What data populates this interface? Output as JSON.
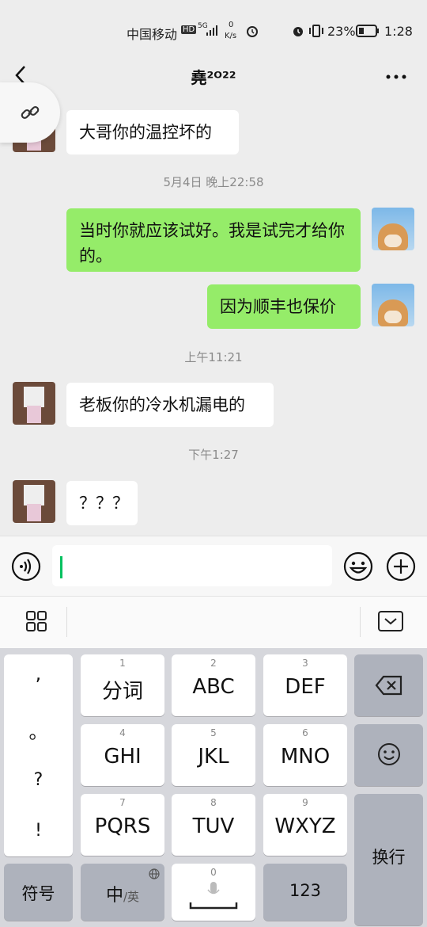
{
  "status_bar": {
    "carrier": "中国移动",
    "hd_badge": "HD",
    "net_type": "5G",
    "speed_value": "0",
    "speed_unit": "K/s",
    "battery_percent": "23%",
    "time": "1:28"
  },
  "chat": {
    "title": "堯²ᴼ²²",
    "messages": [
      {
        "side": "left",
        "text": "大哥你的温控坏的"
      },
      {
        "timestamp": "5月4日 晚上22:58"
      },
      {
        "side": "right",
        "text": "当时你就应该试好。我是试完才给你的。"
      },
      {
        "side": "right",
        "text": "因为顺丰也保价"
      },
      {
        "timestamp": "上午11:21"
      },
      {
        "side": "left",
        "text": "老板你的冷水机漏电的"
      },
      {
        "timestamp": "下午1:27"
      },
      {
        "side": "left",
        "text": "？？？"
      }
    ]
  },
  "input": {
    "value": ""
  },
  "keyboard": {
    "punct": [
      ",",
      "。",
      "?",
      "!"
    ],
    "keys": [
      {
        "num": "1",
        "label": "分词"
      },
      {
        "num": "2",
        "label": "ABC"
      },
      {
        "num": "3",
        "label": "DEF"
      },
      {
        "num": "4",
        "label": "GHI"
      },
      {
        "num": "5",
        "label": "JKL"
      },
      {
        "num": "6",
        "label": "MNO"
      },
      {
        "num": "7",
        "label": "PQRS"
      },
      {
        "num": "8",
        "label": "TUV"
      },
      {
        "num": "9",
        "label": "WXYZ"
      }
    ],
    "symbols_label": "符号",
    "lang_main": "中",
    "lang_sub": "/英",
    "space_num": "0",
    "numbers_label": "123",
    "enter_label": "换行"
  }
}
